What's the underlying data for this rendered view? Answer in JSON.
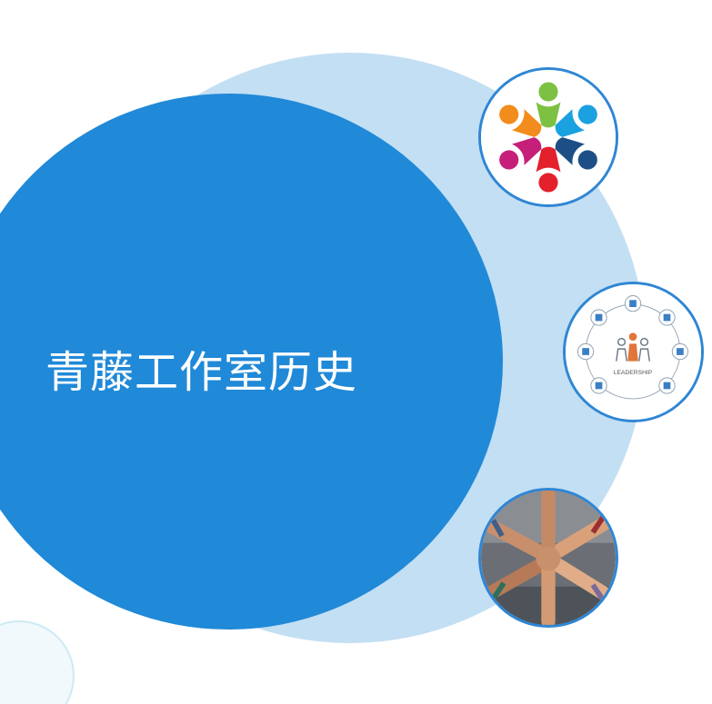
{
  "slide": {
    "title": "青藤工作室历史"
  },
  "images": {
    "teamwork": {
      "icon": "people-circle-icon"
    },
    "leadership": {
      "icon": "leadership-diagram-icon",
      "caption": "LEADERSHIP"
    },
    "hands": {
      "icon": "joined-hands-photo"
    }
  },
  "colors": {
    "main_circle": "#2089d8",
    "light_circle": "#c3dff3",
    "thumb_border": "#2f86d4",
    "title_text": "#ffffff"
  }
}
